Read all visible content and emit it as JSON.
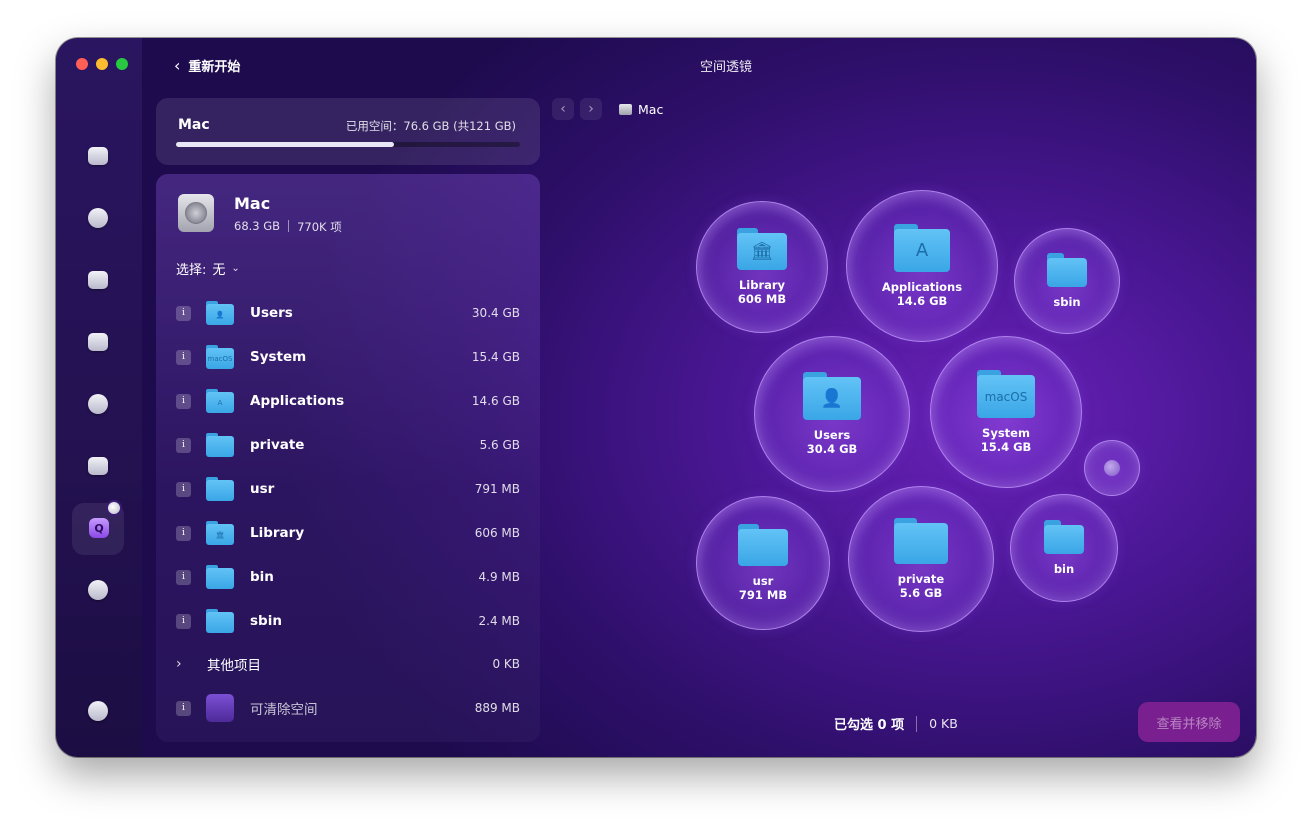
{
  "window": {
    "title": "空间透镜",
    "back_label": "重新开始"
  },
  "sidebar": {
    "items": [
      {
        "icon": "monitor-icon"
      },
      {
        "icon": "shield-icon"
      },
      {
        "icon": "hand-icon"
      },
      {
        "icon": "lightning-icon"
      },
      {
        "icon": "app-store-icon"
      },
      {
        "icon": "folder-icon"
      },
      {
        "icon": "space-lens-icon",
        "active": true
      },
      {
        "icon": "cloud-icon"
      }
    ],
    "bottom_icon": "assistant-icon"
  },
  "disk_card": {
    "name": "Mac",
    "used_text": "已用空间：76.6 GB (共121 GB)",
    "used_fraction": 0.633
  },
  "panel": {
    "title": "Mac",
    "size": "68.3 GB",
    "items_count": "770K 项",
    "select_label": "选择:",
    "select_value": "无",
    "rows": [
      {
        "name": "Users",
        "size": "30.4 GB",
        "glyph": "👤"
      },
      {
        "name": "System",
        "size": "15.4 GB",
        "glyph": "macOS"
      },
      {
        "name": "Applications",
        "size": "14.6 GB",
        "glyph": "A"
      },
      {
        "name": "private",
        "size": "5.6 GB",
        "glyph": ""
      },
      {
        "name": "usr",
        "size": "791 MB",
        "glyph": ""
      },
      {
        "name": "Library",
        "size": "606 MB",
        "glyph": "🏛"
      },
      {
        "name": "bin",
        "size": "4.9 MB",
        "glyph": ""
      },
      {
        "name": "sbin",
        "size": "2.4 MB",
        "glyph": ""
      }
    ],
    "other": {
      "name": "其他项目",
      "size": "0 KB"
    },
    "purgeable": {
      "name": "可清除空间",
      "size": "889 MB"
    }
  },
  "breadcrumb": {
    "label": "Mac"
  },
  "bubbles": [
    {
      "name": "Library",
      "size": "606 MB"
    },
    {
      "name": "Applications",
      "size": "14.6 GB"
    },
    {
      "name": "sbin",
      "size": ""
    },
    {
      "name": "Users",
      "size": "30.4 GB"
    },
    {
      "name": "System",
      "size": "15.4 GB"
    },
    {
      "name": "usr",
      "size": "791 MB"
    },
    {
      "name": "private",
      "size": "5.6 GB"
    },
    {
      "name": "bin",
      "size": ""
    }
  ],
  "status": {
    "selected": "已勾选 0 项",
    "size": "0 KB"
  },
  "remove_button": "查看并移除",
  "colors": {
    "accent": "#7a1f8f",
    "folder": "#4db4ef",
    "bubble_border": "#c8a0ff"
  }
}
